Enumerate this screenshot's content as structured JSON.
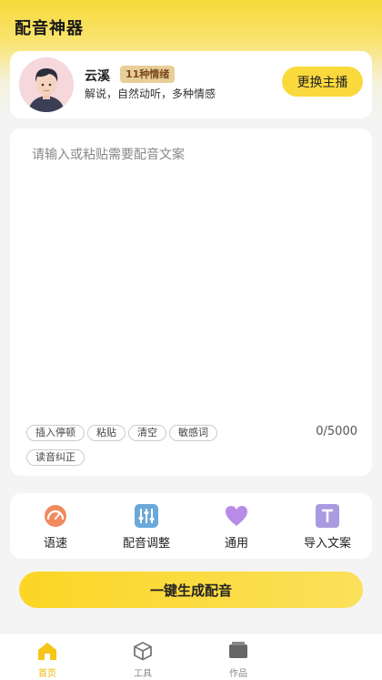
{
  "app": {
    "title": "配音神器"
  },
  "anchor": {
    "name": "云溪",
    "badge": "11种情绪",
    "description": "解说，自然动听，多种情感",
    "change_label": "更换主播"
  },
  "editor": {
    "placeholder": "请输入或粘贴需要配音文案",
    "chips": [
      "插入停顿",
      "粘贴",
      "清空",
      "敏感词",
      "读音纠正"
    ],
    "counter": "0/5000"
  },
  "tools": [
    {
      "label": "语速",
      "icon": "speedometer-icon"
    },
    {
      "label": "配音调整",
      "icon": "equalizer-icon"
    },
    {
      "label": "通用",
      "icon": "heart-icon"
    },
    {
      "label": "导入文案",
      "icon": "text-import-icon"
    }
  ],
  "generate": {
    "label": "一键生成配音"
  },
  "nav": [
    {
      "label": "首页",
      "icon": "home-icon",
      "active": true
    },
    {
      "label": "工具",
      "icon": "cube-icon",
      "active": false
    },
    {
      "label": "作品",
      "icon": "works-icon",
      "active": false
    }
  ],
  "colors": {
    "accent": "#fad93d",
    "active_nav": "#f2b705",
    "badge_bg": "#e8cf9a"
  }
}
